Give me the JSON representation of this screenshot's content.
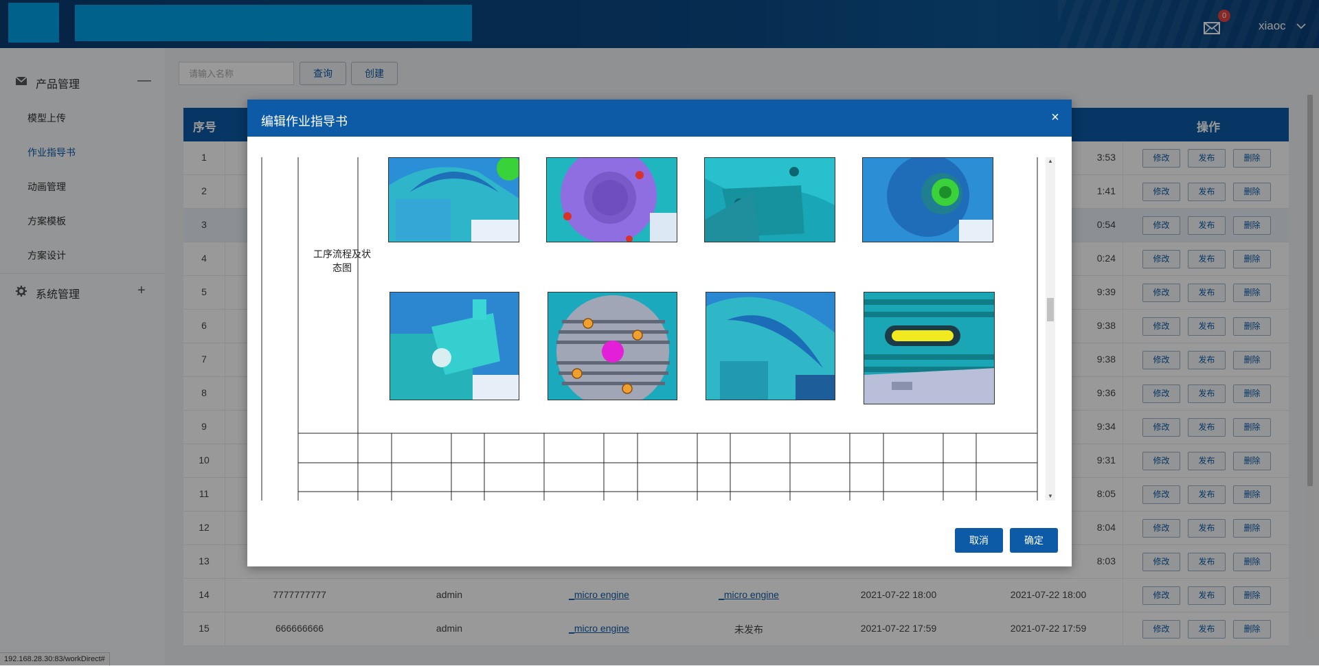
{
  "header": {
    "user_name": "xiaoc",
    "mail_badge": "0",
    "colors": {
      "header_bg": "#0b4a86",
      "logo_block": "#00a2e8"
    }
  },
  "sidebar": {
    "groups": [
      {
        "label": "产品管理",
        "icon": "mail-box-icon",
        "toggle": "—"
      },
      {
        "label": "系统管理",
        "icon": "gear-icon",
        "toggle": "+"
      }
    ],
    "items": [
      {
        "label": "模型上传"
      },
      {
        "label": "作业指导书"
      },
      {
        "label": "动画管理"
      },
      {
        "label": "方案模板"
      },
      {
        "label": "方案设计"
      }
    ]
  },
  "toolbar": {
    "search_placeholder": "请输入名称",
    "query_label": "查询",
    "create_label": "创建"
  },
  "table": {
    "col_index": "序号",
    "col_ops": "操作",
    "btn_edit": "修改",
    "btn_publish": "发布",
    "btn_delete": "删除",
    "rows": [
      {
        "index": "1",
        "time": "3:53"
      },
      {
        "index": "2",
        "time": "1:41"
      },
      {
        "index": "3",
        "time": "0:54"
      },
      {
        "index": "4",
        "time": "0:24"
      },
      {
        "index": "5",
        "time": "9:39"
      },
      {
        "index": "6",
        "time": "9:38"
      },
      {
        "index": "7",
        "time": "9:38"
      },
      {
        "index": "8",
        "time": "9:36"
      },
      {
        "index": "9",
        "time": "9:34"
      },
      {
        "index": "10",
        "time": "9:31"
      },
      {
        "index": "11",
        "time": "8:05"
      },
      {
        "index": "12",
        "time": "8:04"
      },
      {
        "index": "13",
        "time": "8:03"
      },
      {
        "index": "14",
        "name": "7777777777",
        "user": "admin",
        "model": "_micro engine",
        "status": "_micro engine",
        "created": "2021-07-22 18:00",
        "updated": "2021-07-22 18:00"
      },
      {
        "index": "15",
        "name": "666666666",
        "user": "admin",
        "model": "_micro engine",
        "status": "未发布",
        "created": "2021-07-22 17:59",
        "updated": "2021-07-22 17:59"
      }
    ]
  },
  "modal": {
    "title": "编辑作业指导书",
    "close": "×",
    "process_label": "工序流程及状态图",
    "cancel_label": "取消",
    "confirm_label": "确定"
  },
  "status_bar": {
    "url": "192.168.28.30:83/workDirect#"
  }
}
